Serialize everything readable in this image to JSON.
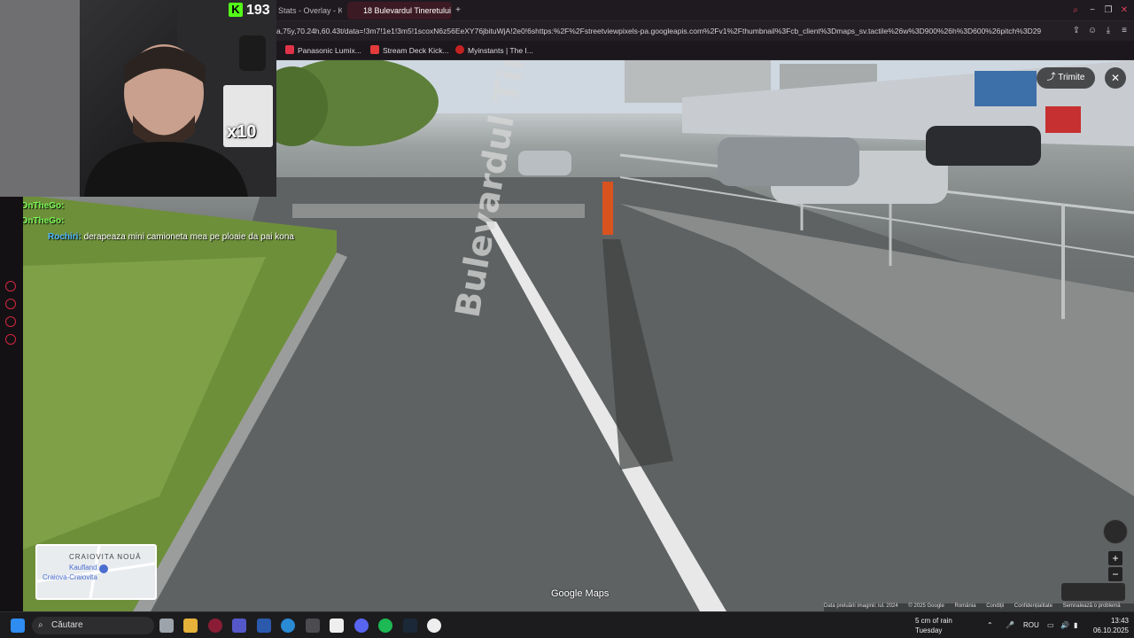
{
  "browser": {
    "tabs": [
      {
        "label": "Stats - Overlay - Kic",
        "active": false
      },
      {
        "label": "18 Bulevardul Tineretului",
        "active": true
      }
    ],
    "url": "a,75y,70.24h,60.43t/data=!3m7!1e1!3m5!1scoxN6z56EeXY76jbituWjA!2e0!6shttps:%2F%2Fstreetviewpixels-pa.googleapis.com%2Fv1%2Fthumbnail%3Fcb_client%3Dmaps_sv.tactile%26w%3D900%26h%3D600%26pitch%3D29",
    "bookmarks": [
      {
        "label": "Panasonic Lumix...",
        "color": "#e0334a"
      },
      {
        "label": "Stream Deck Kick...",
        "color": "#e43b3b"
      },
      {
        "label": "Myinstants | The I...",
        "color": "#c52222"
      }
    ]
  },
  "stream": {
    "follower_count": "193",
    "overlay_multiplier": "x10",
    "chat": [
      {
        "user": "RaiOnTheGo:",
        "message": ""
      },
      {
        "user": "RaiOnTheGo:",
        "message": ""
      },
      {
        "user": "Rochiri:",
        "message": "derapeaza mini camioneta mea pe ploaie da pai kona"
      }
    ]
  },
  "maps": {
    "share_label": "Trimite",
    "close_label": "✕",
    "street_label": "Bulevardul Tineretului",
    "minimap": {
      "area": "CRAIOVITA NOUĂ",
      "place": "Kaufland",
      "sub": "Craiova-Craiovita"
    },
    "brand": "Google Maps",
    "footer": [
      "Data preluării imaginii: iul. 2024",
      "© 2025 Google",
      "România",
      "Condiții",
      "Confidențialitate",
      "Semnalează o problemă"
    ],
    "zoom_in": "+",
    "zoom_out": "−"
  },
  "taskbar": {
    "search_placeholder": "Căutare",
    "weather_line1": "5 cm of rain",
    "weather_line2": "Tuesday",
    "language": "ROU",
    "time": "13:43",
    "date": "06.10.2025"
  }
}
